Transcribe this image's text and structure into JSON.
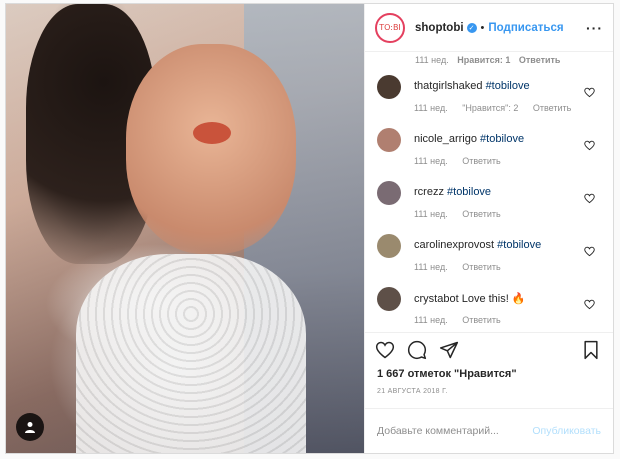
{
  "post": {
    "author": {
      "username": "shoptobi",
      "avatar_text": "TO:BI",
      "follow_label": "Подписаться",
      "separator": "•"
    },
    "previous_comment_meta": {
      "time": "111 нед.",
      "likes": "Нравится: 1",
      "reply": "Ответить"
    },
    "comments": [
      {
        "username": "thatgirlshaked",
        "text": "#tobilove",
        "time": "111 нед.",
        "likes": "\"Нравится\": 2",
        "reply": "Ответить",
        "avatar_color": "#4a3a30"
      },
      {
        "username": "nicole_arrigo",
        "text": "#tobilove",
        "time": "111 нед.",
        "likes": "",
        "reply": "Ответить",
        "avatar_color": "#b07f70"
      },
      {
        "username": "rcrezz",
        "text": "#tobilove",
        "time": "111 нед.",
        "likes": "",
        "reply": "Ответить",
        "avatar_color": "#7a6b73"
      },
      {
        "username": "carolinexprovost",
        "text": "#tobilove",
        "time": "111 нед.",
        "likes": "",
        "reply": "Ответить",
        "avatar_color": "#9a8a6e"
      },
      {
        "username": "crystabot",
        "text": "Love this! 🔥",
        "time": "111 нед.",
        "likes": "",
        "reply": "Ответить",
        "avatar_color": "#5e5048"
      }
    ],
    "likes_text": "1 667 отметок \"Нравится\"",
    "date_text": "21 АВГУСТА 2018 Г.",
    "comment_placeholder": "Добавьте комментарий...",
    "publish_label": "Опубликовать",
    "colors": {
      "link": "#3897f0",
      "hashtag": "#003569",
      "muted": "#8e8e8e",
      "publish_disabled": "#b2dffc"
    }
  }
}
